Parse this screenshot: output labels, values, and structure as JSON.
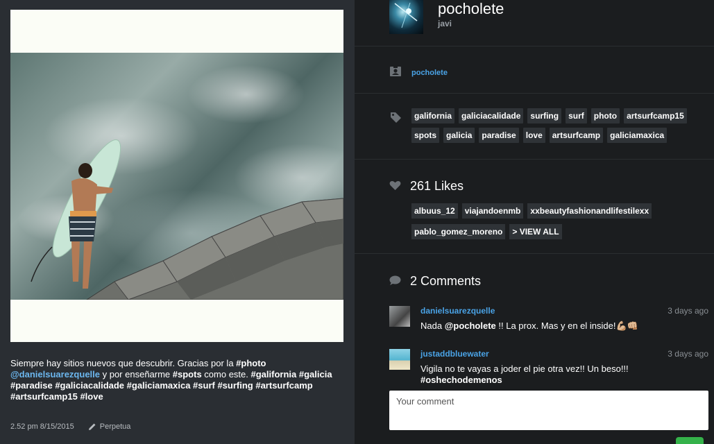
{
  "post": {
    "caption_parts": [
      {
        "t": "Siempre hay sitios nuevos que descubrir. Gracias por la ",
        "s": "plain"
      },
      {
        "t": "#photo",
        "s": "bold"
      },
      {
        "t": " ",
        "s": "plain"
      },
      {
        "t": "@danielsuarezquelle",
        "s": "mention"
      },
      {
        "t": " y por enseñarme ",
        "s": "plain"
      },
      {
        "t": "#spots",
        "s": "bold"
      },
      {
        "t": " como este. ",
        "s": "plain"
      },
      {
        "t": "#galifornia #galicia #paradise #galiciacalidade #galiciamaxica #surf #surfing #artsurfcamp #artsurfcamp15 #love",
        "s": "bold"
      }
    ],
    "time": "2.52 pm 8/15/2015",
    "edit_label": "Perpetua"
  },
  "owner": {
    "username": "pocholete",
    "fullname": "javi",
    "link": "pocholete"
  },
  "tags": [
    "galifornia",
    "galiciacalidade",
    "surfing",
    "surf",
    "photo",
    "artsurfcamp15",
    "spots",
    "galicia",
    "paradise",
    "love",
    "artsurfcamp",
    "galiciamaxica"
  ],
  "likes": {
    "title": "261 Likes",
    "users": [
      "albuus_12",
      "viajandoenmb",
      "xxbeautyfashionandlifestilexx",
      "pablo_gomez_moreno"
    ],
    "view_all": "> VIEW ALL"
  },
  "comments": {
    "title": "2 Comments",
    "items": [
      {
        "user": "danielsuarezquelle",
        "time": "3 days ago",
        "parts": [
          {
            "t": "Nada ",
            "s": "plain"
          },
          {
            "t": "@pocholete",
            "s": "bold"
          },
          {
            "t": " !! La prox. Mas y en el inside!💪🏼👊🏼",
            "s": "plain"
          }
        ]
      },
      {
        "user": "justaddbluewater",
        "time": "3 days ago",
        "parts": [
          {
            "t": "Vigila no te vayas a joder el pie otra vez!! Un beso!!! ",
            "s": "plain"
          },
          {
            "t": "#oshechodemenos",
            "s": "bold"
          }
        ]
      }
    ],
    "placeholder": "Your comment"
  },
  "colors": {
    "link": "#4aa3e6",
    "send": "#35b24a"
  }
}
